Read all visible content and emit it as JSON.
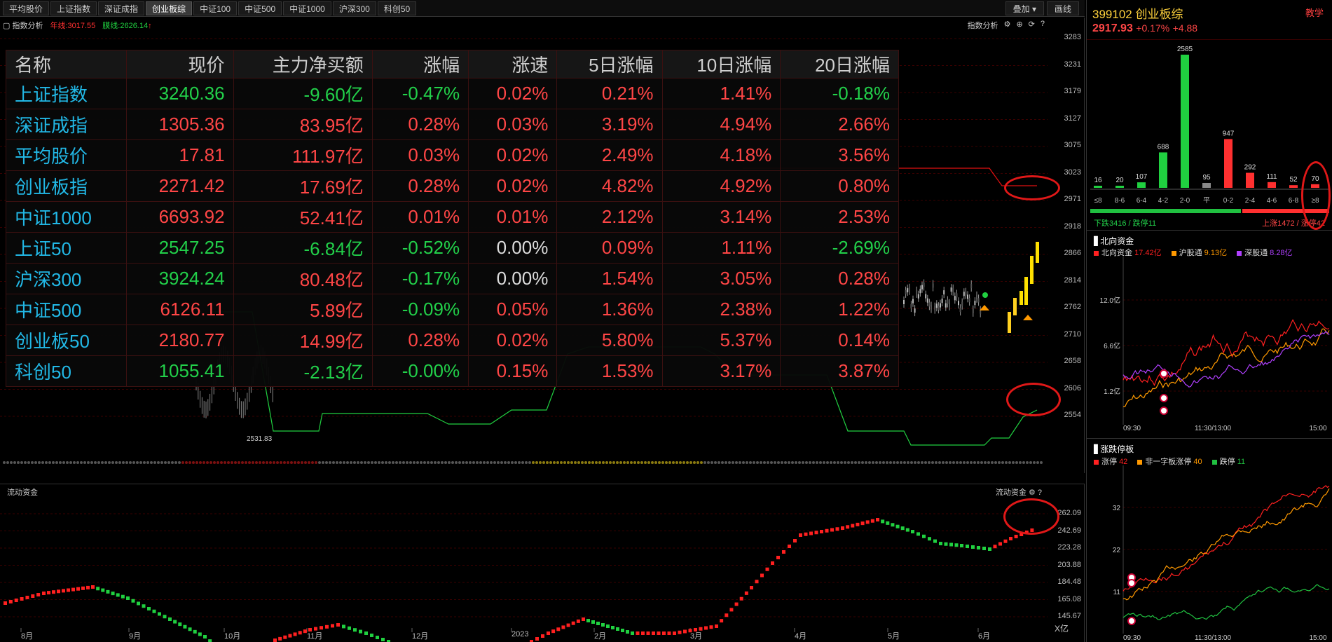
{
  "tabs": [
    "平均股价",
    "上证指数",
    "深证成指",
    "创业板综",
    "中证100",
    "中证500",
    "中证1000",
    "沪深300",
    "科创50"
  ],
  "active_tab": 3,
  "tab_right": {
    "overlay_label": "叠加",
    "draw_label": "画线"
  },
  "chart_head": {
    "analysis_label": "指数分析",
    "line1_label": "年线:3017.55",
    "line2_label": "膜线:2626.14",
    "right_label": "指数分析"
  },
  "main_yaxis": [
    "3283",
    "3231",
    "3179",
    "3127",
    "3075",
    "3023",
    "2971",
    "2918",
    "2866",
    "2814",
    "2762",
    "2710",
    "2658",
    "2606",
    "2554"
  ],
  "low_marker": "2531.83",
  "quote_table": {
    "headers": [
      "名称",
      "现价",
      "主力净买额",
      "涨幅",
      "涨速",
      "5日涨幅",
      "10日涨幅",
      "20日涨幅"
    ],
    "rows": [
      {
        "name": "上证指数",
        "cells": [
          [
            "3240.36",
            "down"
          ],
          [
            "-9.60亿",
            "down"
          ],
          [
            "-0.47%",
            "down"
          ],
          [
            "0.02%",
            "up"
          ],
          [
            "0.21%",
            "up"
          ],
          [
            "1.41%",
            "up"
          ],
          [
            "-0.18%",
            "down"
          ]
        ]
      },
      {
        "name": "深证成指",
        "cells": [
          [
            "1305.36",
            "up"
          ],
          [
            "83.95亿",
            "up"
          ],
          [
            "0.28%",
            "up"
          ],
          [
            "0.03%",
            "up"
          ],
          [
            "3.19%",
            "up"
          ],
          [
            "4.94%",
            "up"
          ],
          [
            "2.66%",
            "up"
          ]
        ]
      },
      {
        "name": "平均股价",
        "cells": [
          [
            "17.81",
            "up"
          ],
          [
            "111.97亿",
            "up"
          ],
          [
            "0.03%",
            "up"
          ],
          [
            "0.02%",
            "up"
          ],
          [
            "2.49%",
            "up"
          ],
          [
            "4.18%",
            "up"
          ],
          [
            "3.56%",
            "up"
          ]
        ]
      },
      {
        "name": "创业板指",
        "cells": [
          [
            "2271.42",
            "up"
          ],
          [
            "17.69亿",
            "up"
          ],
          [
            "0.28%",
            "up"
          ],
          [
            "0.02%",
            "up"
          ],
          [
            "4.82%",
            "up"
          ],
          [
            "4.92%",
            "up"
          ],
          [
            "0.80%",
            "up"
          ]
        ]
      },
      {
        "name": "中证1000",
        "cells": [
          [
            "6693.92",
            "up"
          ],
          [
            "52.41亿",
            "up"
          ],
          [
            "0.01%",
            "up"
          ],
          [
            "0.01%",
            "up"
          ],
          [
            "2.12%",
            "up"
          ],
          [
            "3.14%",
            "up"
          ],
          [
            "2.53%",
            "up"
          ]
        ]
      },
      {
        "name": "上证50",
        "cells": [
          [
            "2547.25",
            "down"
          ],
          [
            "-6.84亿",
            "down"
          ],
          [
            "-0.52%",
            "down"
          ],
          [
            "0.00%",
            "flat"
          ],
          [
            "0.09%",
            "up"
          ],
          [
            "1.11%",
            "up"
          ],
          [
            "-2.69%",
            "down"
          ]
        ]
      },
      {
        "name": "沪深300",
        "cells": [
          [
            "3924.24",
            "down"
          ],
          [
            "80.48亿",
            "up"
          ],
          [
            "-0.17%",
            "down"
          ],
          [
            "0.00%",
            "flat"
          ],
          [
            "1.54%",
            "up"
          ],
          [
            "3.05%",
            "up"
          ],
          [
            "0.28%",
            "up"
          ]
        ]
      },
      {
        "name": "中证500",
        "cells": [
          [
            "6126.11",
            "up"
          ],
          [
            "5.89亿",
            "up"
          ],
          [
            "-0.09%",
            "down"
          ],
          [
            "0.05%",
            "up"
          ],
          [
            "1.36%",
            "up"
          ],
          [
            "2.38%",
            "up"
          ],
          [
            "1.22%",
            "up"
          ]
        ]
      },
      {
        "name": "创业板50",
        "cells": [
          [
            "2180.77",
            "up"
          ],
          [
            "14.99亿",
            "up"
          ],
          [
            "0.28%",
            "up"
          ],
          [
            "0.02%",
            "up"
          ],
          [
            "5.80%",
            "up"
          ],
          [
            "5.37%",
            "up"
          ],
          [
            "0.14%",
            "up"
          ]
        ]
      },
      {
        "name": "科创50",
        "cells": [
          [
            "1055.41",
            "down"
          ],
          [
            "-2.13亿",
            "down"
          ],
          [
            "-0.00%",
            "down"
          ],
          [
            "0.15%",
            "up"
          ],
          [
            "1.53%",
            "up"
          ],
          [
            "3.17%",
            "up"
          ],
          [
            "3.87%",
            "up"
          ]
        ]
      }
    ]
  },
  "bottom": {
    "title": "流动资金",
    "right_title": "流动资金",
    "yaxis": [
      "262.09",
      "242.69",
      "223.28",
      "203.88",
      "184.48",
      "165.08",
      "145.67"
    ],
    "xaxis": [
      "8月",
      "9月",
      "10月",
      "11月",
      "12月",
      "2023",
      "2月",
      "3月",
      "4月",
      "5月",
      "6月"
    ],
    "unit": "X亿"
  },
  "right": {
    "title": "399102 创业板综",
    "teach": "教学",
    "price": "2917.93",
    "change_pct": "+0.17%",
    "change_abs": "+4.88",
    "dist": {
      "labels": [
        "≤8",
        "8-6",
        "6-4",
        "4-2",
        "2-0",
        "平",
        "0-2",
        "2-4",
        "4-6",
        "6-8",
        "≥8"
      ],
      "values": [
        16,
        20,
        107,
        688,
        2585,
        95,
        947,
        292,
        111,
        52,
        70
      ],
      "down_text": "下跌3416 / 跌停11",
      "up_text": "上涨1472 / 涨停42"
    },
    "north": {
      "title": "北向资金",
      "legend": [
        {
          "label": "北向资金",
          "value": "17.42亿",
          "color": "#ff2020"
        },
        {
          "label": "沪股通",
          "value": "9.13亿",
          "color": "#ff9900"
        },
        {
          "label": "深股通",
          "value": "8.28亿",
          "color": "#b040ff"
        }
      ],
      "yaxis": [
        "12.0亿",
        "6.6亿",
        "1.2亿"
      ],
      "xaxis": [
        "09:30",
        "11:30/13:00",
        "15:00"
      ]
    },
    "limit": {
      "title": "涨跌停板",
      "legend": [
        {
          "label": "涨停",
          "value": "42",
          "color": "#ff2020"
        },
        {
          "label": "非一字板涨停",
          "value": "40",
          "color": "#ff9900"
        },
        {
          "label": "跌停",
          "value": "11",
          "color": "#20c040"
        }
      ],
      "yaxis": [
        "32",
        "22",
        "11"
      ],
      "xaxis": [
        "09:30",
        "11:30/13:00",
        "15:00"
      ]
    }
  }
}
